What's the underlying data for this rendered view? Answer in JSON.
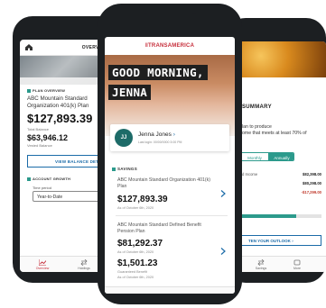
{
  "left_phone": {
    "header_title": "OVERVIEW",
    "section_label": "PLAN OVERVIEW",
    "plan_name": "ABC Mountain Standard Organization 401(k) Plan",
    "total_balance": "$127,893.39",
    "total_balance_label": "Total Balance",
    "vested_balance": "$63,946.12",
    "vested_balance_label": "Vested Balance",
    "view_details_label": "VIEW BALANCE DETAILS",
    "account_growth_label": "ACCOUNT GROWTH",
    "time_period_label": "Time period",
    "time_period_value": "Year-to-Date",
    "tabs": [
      {
        "label": "Overview",
        "icon": "chart-icon"
      },
      {
        "label": "Holdings",
        "icon": "swap-icon"
      }
    ]
  },
  "center_phone": {
    "brand": "TRANSAMERICA",
    "greeting_line1": "GOOD MORNING,",
    "greeting_line2": "JENNA",
    "user": {
      "initials": "JJ",
      "name": "Jenna Jones",
      "last_login": "Last login: 00/00/0000 3:00 PM"
    },
    "savings_label": "SAVINGS",
    "accounts": [
      {
        "name": "ABC Mountain Standard Organization 401(k) Plan",
        "balance": "$127,893.39",
        "as_of": "As of October 6th, 2020"
      },
      {
        "name": "ABC Mountain Standard Defined Benefit Pension Plan",
        "balance": "$81,292.37",
        "as_of": "As of October 6th, 2020"
      },
      {
        "name": "",
        "balance": "$1,501.23",
        "sub": "Guaranteed Benefit",
        "as_of": "As of October 6th, 2020"
      }
    ]
  },
  "right_phone": {
    "heading": "SUMMARY",
    "body_lines": [
      "lan to produce",
      "ome that meets at least 70% of"
    ],
    "toggle": {
      "monthly": "Monthly",
      "annually": "Annually"
    },
    "rows": [
      {
        "label": "d Income",
        "value": "$82,398.00",
        "negative": false
      },
      {
        "label": "",
        "value": "$80,298.00",
        "negative": false
      },
      {
        "label": "",
        "value": "-$17,299.00",
        "negative": true
      }
    ],
    "outlook_button_label": "TEN YOUR OUTLOOK",
    "tabs": [
      {
        "label": "Savings"
      },
      {
        "label": "More"
      }
    ]
  }
}
